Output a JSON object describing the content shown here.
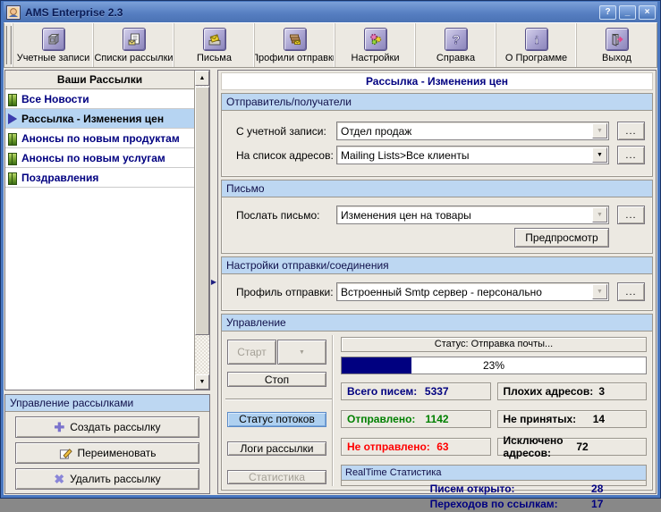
{
  "window": {
    "title": "AMS Enterprise 2.3",
    "controls": {
      "help": "?",
      "minimize": "_",
      "close": "×"
    }
  },
  "toolbar": {
    "items": [
      {
        "label": "Учетные записи",
        "icon": "accounts-icon"
      },
      {
        "label": "Списки рассылки",
        "icon": "mailing-lists-icon"
      },
      {
        "label": "Письма",
        "icon": "letters-icon"
      },
      {
        "label": "Профили отправки",
        "icon": "send-profiles-icon"
      },
      {
        "label": "Настройки",
        "icon": "settings-icon"
      },
      {
        "label": "Справка",
        "icon": "help-icon"
      },
      {
        "label": "О Программе",
        "icon": "about-icon"
      },
      {
        "label": "Выход",
        "icon": "exit-icon"
      }
    ]
  },
  "sidebar": {
    "header": "Ваши Рассылки",
    "items": [
      {
        "label": "Все Новости",
        "state": "paused",
        "selected": false
      },
      {
        "label": "Рассылка - Изменения цен",
        "state": "running",
        "selected": true
      },
      {
        "label": "Анонсы по новым продуктам",
        "state": "paused",
        "selected": false
      },
      {
        "label": "Анонсы по новым услугам",
        "state": "paused",
        "selected": false
      },
      {
        "label": "Поздравления",
        "state": "paused",
        "selected": false
      }
    ],
    "manage": {
      "header": "Управление рассылками",
      "create": "Создать рассылку",
      "rename": "Переименовать",
      "delete": "Удалить рассылку"
    }
  },
  "main": {
    "title": "Рассылка - Изменения цен",
    "sender": {
      "header": "Отправитель/получатели",
      "account_label": "С учетной записи:",
      "account_value": "Отдел продаж",
      "list_label": "На список адресов:",
      "list_value": "Mailing Lists>Все клиенты",
      "browse": "..."
    },
    "letter": {
      "header": "Письмо",
      "label": "Послать письмо:",
      "value": "Изменения цен на товары",
      "browse": "...",
      "preview": "Предпросмотр"
    },
    "profile": {
      "header": "Настройки отправки/соединения",
      "label": "Профиль отправки:",
      "value": "Встроенный Smtp сервер - персонально",
      "browse": "..."
    },
    "control": {
      "header": "Управление",
      "start": "Старт",
      "stop": "Стоп",
      "threads": "Статус потоков",
      "logs": "Логи рассылки",
      "statistics": "Статистика",
      "status": "Статус: Отправка почты...",
      "progress": {
        "percent": 23,
        "label": "23%",
        "width": "23%",
        "fill_color": "#000080"
      },
      "stats": [
        {
          "label": "Всего писем:",
          "value": "5337",
          "color": "#000080"
        },
        {
          "label": "Плохих адресов:",
          "value": "3",
          "color": "#000000"
        },
        {
          "label": "Отправлено:",
          "value": "1142",
          "color": "#008000"
        },
        {
          "label": "Не принятых:",
          "value": "14",
          "color": "#000000"
        },
        {
          "label": "Не отправлено:",
          "value": "63",
          "color": "#ff0000"
        },
        {
          "label": "Исключено адресов:",
          "value": "72",
          "color": "#000000"
        }
      ],
      "realtime": {
        "header": "RealTime Статистика",
        "rows": [
          {
            "label": "Писем открыто:",
            "value": "28"
          },
          {
            "label": "Переходов по ссылкам:",
            "value": "17"
          }
        ]
      }
    }
  },
  "colors": {
    "accent_band": "#bdd7f2",
    "selected_row": "#b6d4f2",
    "titlebar": "#577fc2",
    "navy": "#000080",
    "green": "#008000",
    "red": "#ff0000"
  }
}
